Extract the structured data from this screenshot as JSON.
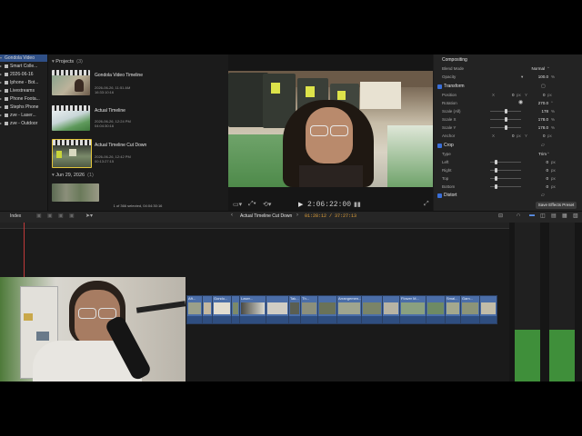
{
  "libraries": {
    "items": [
      {
        "label": "Gondola Video",
        "selected": true
      },
      {
        "label": "Smart Colle...",
        "selected": false
      },
      {
        "label": "2026-06-16",
        "selected": false
      },
      {
        "label": "Iphone - Bot...",
        "selected": false
      },
      {
        "label": "Livestreams",
        "selected": false
      },
      {
        "label": "Phone Foota...",
        "selected": false
      },
      {
        "label": "Stephs Phone",
        "selected": false
      },
      {
        "label": "zve - Laser...",
        "selected": false
      },
      {
        "label": "zve - Outdoor",
        "selected": false
      }
    ]
  },
  "browser": {
    "projects_header": "Projects",
    "projects_count": "(3)",
    "clips": [
      {
        "title": "Gondola Video Timeline",
        "date": "2026-06-26, 11:51 AM",
        "duration": "16:33:10:16"
      },
      {
        "title": "Actual Timeline",
        "date": "2026-06-26, 12:24 PM",
        "duration": "04:04:30:16"
      },
      {
        "title": "Actual Timeline Cut Down",
        "date": "2026-06-26, 12:42 PM",
        "duration": "00:13:27:15"
      }
    ],
    "date_group": "Jun 29, 2026",
    "date_group_count": "(1)",
    "status": "1 of 366 selected, 04:04:30:16"
  },
  "viewer": {
    "timecode": "2:06:22:00"
  },
  "inspector": {
    "compositing_header": "Compositing",
    "blend_mode_label": "Blend Mode",
    "blend_mode_value": "Normal",
    "opacity_label": "Opacity",
    "opacity_value": "100.0",
    "opacity_unit": "%",
    "transform_header": "Transform",
    "position_label": "Position",
    "position_x": "0",
    "position_y": "0",
    "position_unit": "px",
    "rotation_label": "Rotation",
    "rotation_value": "270.0",
    "rotation_unit": "°",
    "scale_all_label": "Scale (All)",
    "scale_all_value": "178",
    "scale_x_label": "Scale X",
    "scale_x_value": "178.0",
    "scale_y_label": "Scale Y",
    "scale_y_value": "178.0",
    "scale_unit": "%",
    "anchor_label": "Anchor",
    "anchor_x": "0",
    "anchor_y": "0",
    "crop_header": "Crop",
    "type_label": "Type",
    "type_value": "Trim",
    "left_label": "Left",
    "left_value": "0",
    "right_label": "Right",
    "right_value": "0",
    "top_label": "Top",
    "top_value": "0",
    "bottom_label": "Bottom",
    "bottom_value": "0",
    "crop_unit": "px",
    "distort_header": "Distort",
    "save_preset": "Save Effects Preset",
    "x_label": "X",
    "y_label": "Y"
  },
  "timeline": {
    "index_label": "Index",
    "project_name": "Actual Timeline Cut Down",
    "timecode": "01:28:12 / 37:27:13",
    "clip_labels": [
      "Aft...",
      "Gondo...",
      "Laser...",
      "Tak...",
      "Th...",
      "Arrangemen...",
      "Flower M...",
      "Smal...",
      "Gam..."
    ],
    "meter_labels": [
      "6",
      "0",
      "-6",
      "-12",
      "-20",
      "-30",
      "-50",
      "-∞"
    ]
  },
  "colors": {
    "accent": "#3a6fd8",
    "clip_blue": "#4b6ea8",
    "selection": "#2f4f86",
    "timecode_accent": "#e3a23b",
    "meter_green": "#3f8f3a"
  }
}
